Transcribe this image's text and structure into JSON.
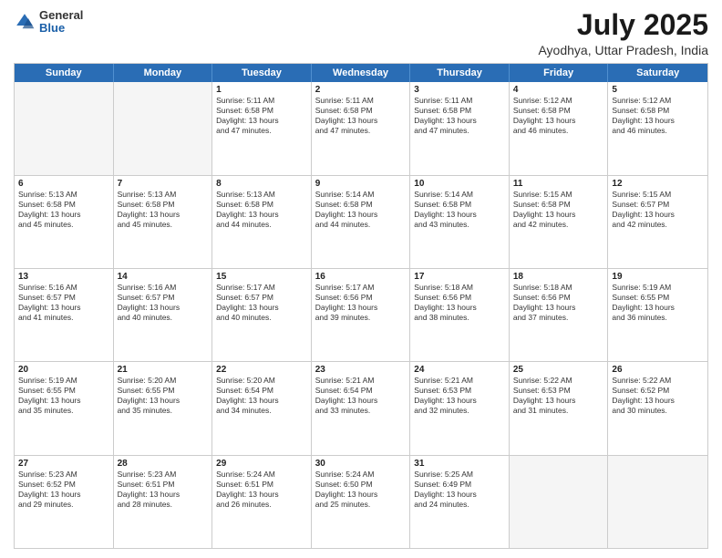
{
  "logo": {
    "general": "General",
    "blue": "Blue"
  },
  "title": "July 2025",
  "subtitle": "Ayodhya, Uttar Pradesh, India",
  "header_days": [
    "Sunday",
    "Monday",
    "Tuesday",
    "Wednesday",
    "Thursday",
    "Friday",
    "Saturday"
  ],
  "weeks": [
    [
      {
        "day": "",
        "lines": []
      },
      {
        "day": "",
        "lines": []
      },
      {
        "day": "1",
        "lines": [
          "Sunrise: 5:11 AM",
          "Sunset: 6:58 PM",
          "Daylight: 13 hours",
          "and 47 minutes."
        ]
      },
      {
        "day": "2",
        "lines": [
          "Sunrise: 5:11 AM",
          "Sunset: 6:58 PM",
          "Daylight: 13 hours",
          "and 47 minutes."
        ]
      },
      {
        "day": "3",
        "lines": [
          "Sunrise: 5:11 AM",
          "Sunset: 6:58 PM",
          "Daylight: 13 hours",
          "and 47 minutes."
        ]
      },
      {
        "day": "4",
        "lines": [
          "Sunrise: 5:12 AM",
          "Sunset: 6:58 PM",
          "Daylight: 13 hours",
          "and 46 minutes."
        ]
      },
      {
        "day": "5",
        "lines": [
          "Sunrise: 5:12 AM",
          "Sunset: 6:58 PM",
          "Daylight: 13 hours",
          "and 46 minutes."
        ]
      }
    ],
    [
      {
        "day": "6",
        "lines": [
          "Sunrise: 5:13 AM",
          "Sunset: 6:58 PM",
          "Daylight: 13 hours",
          "and 45 minutes."
        ]
      },
      {
        "day": "7",
        "lines": [
          "Sunrise: 5:13 AM",
          "Sunset: 6:58 PM",
          "Daylight: 13 hours",
          "and 45 minutes."
        ]
      },
      {
        "day": "8",
        "lines": [
          "Sunrise: 5:13 AM",
          "Sunset: 6:58 PM",
          "Daylight: 13 hours",
          "and 44 minutes."
        ]
      },
      {
        "day": "9",
        "lines": [
          "Sunrise: 5:14 AM",
          "Sunset: 6:58 PM",
          "Daylight: 13 hours",
          "and 44 minutes."
        ]
      },
      {
        "day": "10",
        "lines": [
          "Sunrise: 5:14 AM",
          "Sunset: 6:58 PM",
          "Daylight: 13 hours",
          "and 43 minutes."
        ]
      },
      {
        "day": "11",
        "lines": [
          "Sunrise: 5:15 AM",
          "Sunset: 6:58 PM",
          "Daylight: 13 hours",
          "and 42 minutes."
        ]
      },
      {
        "day": "12",
        "lines": [
          "Sunrise: 5:15 AM",
          "Sunset: 6:57 PM",
          "Daylight: 13 hours",
          "and 42 minutes."
        ]
      }
    ],
    [
      {
        "day": "13",
        "lines": [
          "Sunrise: 5:16 AM",
          "Sunset: 6:57 PM",
          "Daylight: 13 hours",
          "and 41 minutes."
        ]
      },
      {
        "day": "14",
        "lines": [
          "Sunrise: 5:16 AM",
          "Sunset: 6:57 PM",
          "Daylight: 13 hours",
          "and 40 minutes."
        ]
      },
      {
        "day": "15",
        "lines": [
          "Sunrise: 5:17 AM",
          "Sunset: 6:57 PM",
          "Daylight: 13 hours",
          "and 40 minutes."
        ]
      },
      {
        "day": "16",
        "lines": [
          "Sunrise: 5:17 AM",
          "Sunset: 6:56 PM",
          "Daylight: 13 hours",
          "and 39 minutes."
        ]
      },
      {
        "day": "17",
        "lines": [
          "Sunrise: 5:18 AM",
          "Sunset: 6:56 PM",
          "Daylight: 13 hours",
          "and 38 minutes."
        ]
      },
      {
        "day": "18",
        "lines": [
          "Sunrise: 5:18 AM",
          "Sunset: 6:56 PM",
          "Daylight: 13 hours",
          "and 37 minutes."
        ]
      },
      {
        "day": "19",
        "lines": [
          "Sunrise: 5:19 AM",
          "Sunset: 6:55 PM",
          "Daylight: 13 hours",
          "and 36 minutes."
        ]
      }
    ],
    [
      {
        "day": "20",
        "lines": [
          "Sunrise: 5:19 AM",
          "Sunset: 6:55 PM",
          "Daylight: 13 hours",
          "and 35 minutes."
        ]
      },
      {
        "day": "21",
        "lines": [
          "Sunrise: 5:20 AM",
          "Sunset: 6:55 PM",
          "Daylight: 13 hours",
          "and 35 minutes."
        ]
      },
      {
        "day": "22",
        "lines": [
          "Sunrise: 5:20 AM",
          "Sunset: 6:54 PM",
          "Daylight: 13 hours",
          "and 34 minutes."
        ]
      },
      {
        "day": "23",
        "lines": [
          "Sunrise: 5:21 AM",
          "Sunset: 6:54 PM",
          "Daylight: 13 hours",
          "and 33 minutes."
        ]
      },
      {
        "day": "24",
        "lines": [
          "Sunrise: 5:21 AM",
          "Sunset: 6:53 PM",
          "Daylight: 13 hours",
          "and 32 minutes."
        ]
      },
      {
        "day": "25",
        "lines": [
          "Sunrise: 5:22 AM",
          "Sunset: 6:53 PM",
          "Daylight: 13 hours",
          "and 31 minutes."
        ]
      },
      {
        "day": "26",
        "lines": [
          "Sunrise: 5:22 AM",
          "Sunset: 6:52 PM",
          "Daylight: 13 hours",
          "and 30 minutes."
        ]
      }
    ],
    [
      {
        "day": "27",
        "lines": [
          "Sunrise: 5:23 AM",
          "Sunset: 6:52 PM",
          "Daylight: 13 hours",
          "and 29 minutes."
        ]
      },
      {
        "day": "28",
        "lines": [
          "Sunrise: 5:23 AM",
          "Sunset: 6:51 PM",
          "Daylight: 13 hours",
          "and 28 minutes."
        ]
      },
      {
        "day": "29",
        "lines": [
          "Sunrise: 5:24 AM",
          "Sunset: 6:51 PM",
          "Daylight: 13 hours",
          "and 26 minutes."
        ]
      },
      {
        "day": "30",
        "lines": [
          "Sunrise: 5:24 AM",
          "Sunset: 6:50 PM",
          "Daylight: 13 hours",
          "and 25 minutes."
        ]
      },
      {
        "day": "31",
        "lines": [
          "Sunrise: 5:25 AM",
          "Sunset: 6:49 PM",
          "Daylight: 13 hours",
          "and 24 minutes."
        ]
      },
      {
        "day": "",
        "lines": []
      },
      {
        "day": "",
        "lines": []
      }
    ]
  ]
}
